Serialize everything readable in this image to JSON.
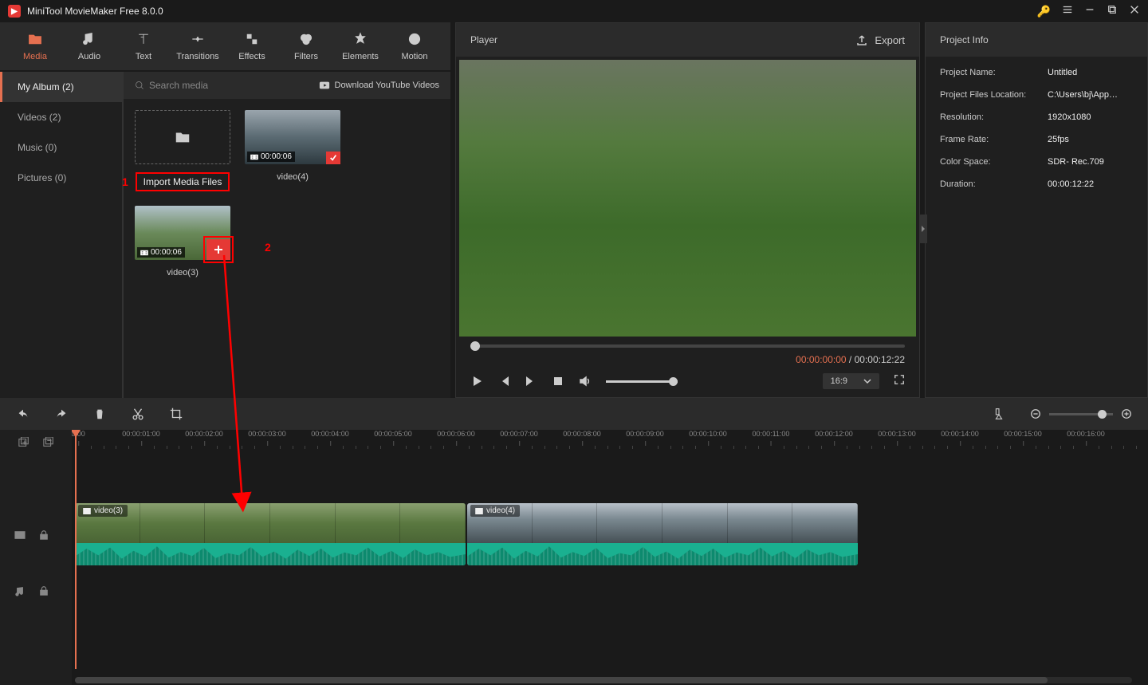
{
  "app": {
    "title": "MiniTool MovieMaker Free 8.0.0"
  },
  "tabs": {
    "media": "Media",
    "audio": "Audio",
    "text": "Text",
    "transitions": "Transitions",
    "effects": "Effects",
    "filters": "Filters",
    "elements": "Elements",
    "motion": "Motion"
  },
  "sidebar": {
    "myalbum": "My Album (2)",
    "videos": "Videos (2)",
    "music": "Music (0)",
    "pictures": "Pictures (0)"
  },
  "mediaToolbar": {
    "searchPlaceholder": "Search media",
    "downloadYT": "Download YouTube Videos"
  },
  "mediaItems": {
    "importLabel": "Import Media Files",
    "video4": {
      "name": "video(4)",
      "duration": "00:00:06"
    },
    "video3": {
      "name": "video(3)",
      "duration": "00:00:06"
    }
  },
  "annotations": {
    "one": "1",
    "two": "2"
  },
  "player": {
    "title": "Player",
    "export": "Export",
    "currentTime": "00:00:00:00",
    "totalTime": "00:00:12:22",
    "sep": " / ",
    "ratio": "16:9"
  },
  "project": {
    "title": "Project Info",
    "rows": {
      "name": {
        "k": "Project Name:",
        "v": "Untitled"
      },
      "loc": {
        "k": "Project Files Location:",
        "v": "C:\\Users\\bj\\App…"
      },
      "res": {
        "k": "Resolution:",
        "v": "1920x1080"
      },
      "fps": {
        "k": "Frame Rate:",
        "v": "25fps"
      },
      "color": {
        "k": "Color Space:",
        "v": "SDR- Rec.709"
      },
      "dur": {
        "k": "Duration:",
        "v": "00:00:12:22"
      }
    }
  },
  "timeline": {
    "ticks": [
      "0:00",
      "00:00:01:00",
      "00:00:02:00",
      "00:00:03:00",
      "00:00:04:00",
      "00:00:05:00",
      "00:00:06:00",
      "00:00:07:00",
      "00:00:08:00",
      "00:00:09:00",
      "00:00:10:00",
      "00:00:11:00",
      "00:00:12:00",
      "00:00:13:00",
      "00:00:14:00",
      "00:00:15:00",
      "00:00:16:00"
    ],
    "clip1": "video(3)",
    "clip2": "video(4)"
  }
}
